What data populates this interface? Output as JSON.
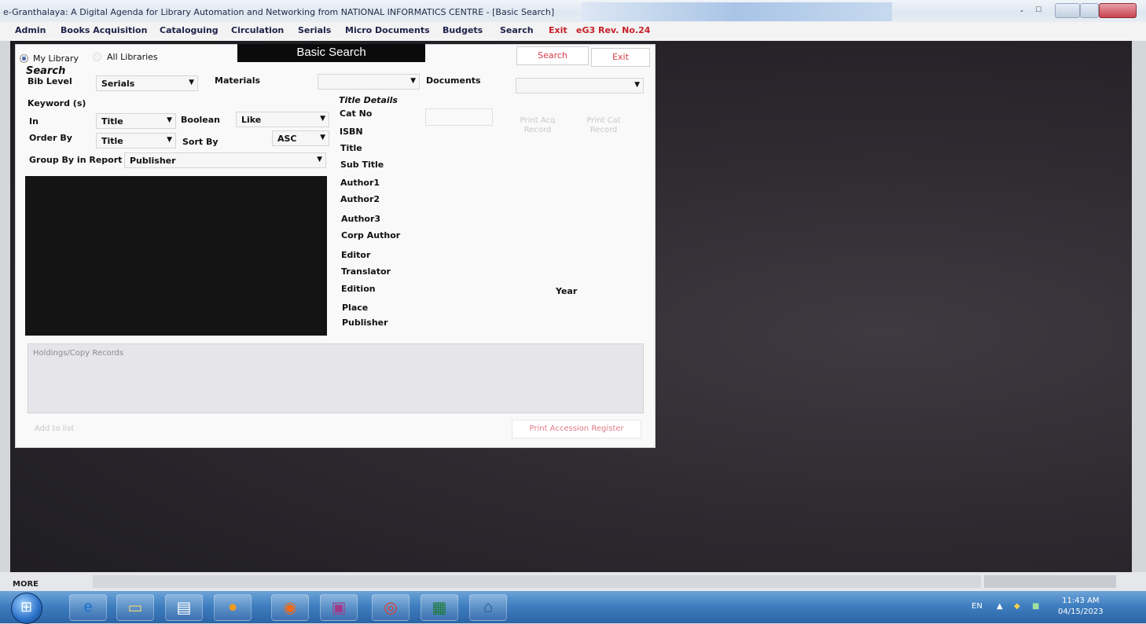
{
  "window": {
    "title": "e-Granthalaya: A Digital Agenda for Library Automation and Networking from NATIONAL INFORMATICS CENTRE - [Basic Search]",
    "min_glyph": "-",
    "max_glyph": "□"
  },
  "menu": {
    "items": [
      "Admin",
      "Books Acquisition",
      "Cataloguing",
      "Circulation",
      "Serials",
      "Micro Documents",
      "Budgets",
      "Search"
    ],
    "exit": "Exit",
    "rev": "eG3 Rev. No.24"
  },
  "form": {
    "radio_my_library": "My Library",
    "radio_all_libraries": "All Libraries",
    "banner": "Basic Search",
    "search_button": "Search",
    "exit_button": "Exit",
    "search_heading": "Search",
    "bib_level_label": "Bib Level",
    "bib_level_value": "Serials",
    "materials_label": "Materials",
    "materials_value": "",
    "documents_label": "Documents",
    "documents_value": "",
    "keyword_label": "Keyword (s)",
    "in_label": "In",
    "in_value": "Title",
    "boolean_label": "Boolean",
    "boolean_value": "Like",
    "order_by_label": "Order By",
    "order_by_value": "Title",
    "sort_by_label": "Sort By",
    "sort_by_value": "ASC",
    "group_by_label": "Group By in Report",
    "group_by_value": "Publisher",
    "title_details_heading": "Title Details",
    "fields": {
      "cat_no": "Cat No",
      "isbn": "ISBN",
      "title": "Title",
      "sub_title": "Sub Title",
      "author1": "Author1",
      "author2": "Author2",
      "author3": "Author3",
      "corp_author": "Corp Author",
      "editor": "Editor",
      "translator": "Translator",
      "edition": "Edition",
      "year": "Year",
      "place": "Place",
      "publisher": "Publisher"
    },
    "print_acq_record": "Print Acq Record",
    "print_cat_record": "Print Cat Record",
    "holdings_caption": "Holdings/Copy Records",
    "add_to_list": "Add to list",
    "print_accession_register": "Print Accession Register"
  },
  "statusbar": {
    "more": "MORE"
  },
  "taskbar": {
    "apps": [
      "windows-start",
      "internet-explorer",
      "file-explorer",
      "notes",
      "media-player",
      "firefox",
      "winrar",
      "chrome",
      "excel",
      "e-granthalaya"
    ],
    "language": "EN",
    "tray_arrow": "▲",
    "time": "11:43 AM",
    "date": "04/15/2023"
  }
}
